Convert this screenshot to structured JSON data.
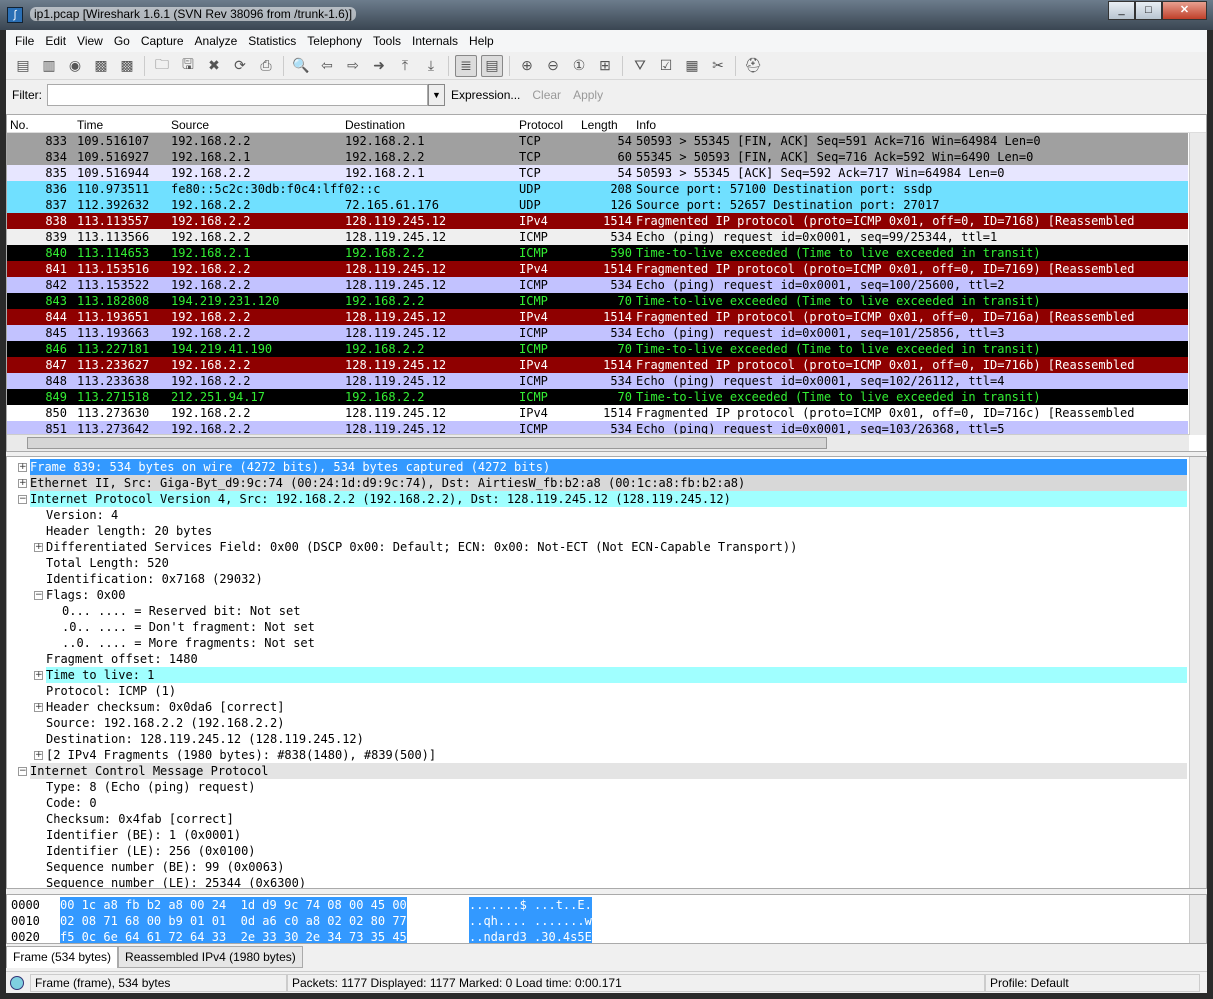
{
  "window": {
    "title": "ip1.pcap  [Wireshark 1.6.1  (SVN Rev 38096 from /trunk-1.6)]",
    "controls": [
      "_",
      "□",
      "✕"
    ]
  },
  "menu": [
    "File",
    "Edit",
    "View",
    "Go",
    "Capture",
    "Analyze",
    "Statistics",
    "Telephony",
    "Tools",
    "Internals",
    "Help"
  ],
  "toolbar": [
    {
      "icon": "interface-list-icon",
      "g": "▤"
    },
    {
      "icon": "capture-options-icon",
      "g": "▥"
    },
    {
      "icon": "capture-start-icon",
      "g": "◉"
    },
    {
      "icon": "capture-stop-icon",
      "g": "▩"
    },
    {
      "icon": "capture-restart-icon",
      "g": "▩"
    },
    {
      "sep": true
    },
    {
      "icon": "open-file-icon",
      "g": "🗀"
    },
    {
      "icon": "save-icon",
      "g": "🖫"
    },
    {
      "icon": "close-file-icon",
      "g": "✖"
    },
    {
      "icon": "reload-icon",
      "g": "⟳"
    },
    {
      "icon": "print-icon",
      "g": "⎙"
    },
    {
      "sep": true
    },
    {
      "icon": "find-icon",
      "g": "🔍"
    },
    {
      "icon": "go-back-icon",
      "g": "⇦"
    },
    {
      "icon": "go-forward-icon",
      "g": "⇨"
    },
    {
      "icon": "go-to-packet-icon",
      "g": "➜"
    },
    {
      "icon": "go-first-icon",
      "g": "⤒"
    },
    {
      "icon": "go-last-icon",
      "g": "⤓"
    },
    {
      "sep": true
    },
    {
      "icon": "colorize-icon",
      "g": "≣",
      "on": true
    },
    {
      "icon": "autoscroll-icon",
      "g": "▤",
      "on": true
    },
    {
      "sep": true
    },
    {
      "icon": "zoom-in-icon",
      "g": "⊕"
    },
    {
      "icon": "zoom-out-icon",
      "g": "⊖"
    },
    {
      "icon": "zoom-normal-icon",
      "g": "①"
    },
    {
      "icon": "resize-columns-icon",
      "g": "⊞"
    },
    {
      "sep": true
    },
    {
      "icon": "capture-filters-icon",
      "g": "⛛"
    },
    {
      "icon": "display-filters-icon",
      "g": "☑"
    },
    {
      "icon": "coloring-rules-icon",
      "g": "▦"
    },
    {
      "icon": "preferences-icon",
      "g": "✂"
    },
    {
      "sep": true
    },
    {
      "icon": "help-icon",
      "g": "⛑"
    }
  ],
  "filter": {
    "label": "Filter:",
    "value": "",
    "expression": "Expression...",
    "clear": "Clear",
    "apply": "Apply"
  },
  "packet_list": {
    "columns": [
      "No.",
      "Time",
      "Source",
      "Destination",
      "Protocol",
      "Length",
      "Info"
    ],
    "rows": [
      {
        "no": "833",
        "time": "109.516107",
        "src": "192.168.2.2",
        "dst": "192.168.2.1",
        "proto": "TCP",
        "len": "54",
        "info": "50593 > 55345 [FIN, ACK] Seq=591 Ack=716 Win=64984 Len=0",
        "bg": "#a0a0a0",
        "fg": "#000000"
      },
      {
        "no": "834",
        "time": "109.516927",
        "src": "192.168.2.1",
        "dst": "192.168.2.2",
        "proto": "TCP",
        "len": "60",
        "info": "55345 > 50593 [FIN, ACK] Seq=716 Ack=592 Win=6490 Len=0",
        "bg": "#a0a0a0",
        "fg": "#000000"
      },
      {
        "no": "835",
        "time": "109.516944",
        "src": "192.168.2.2",
        "dst": "192.168.2.1",
        "proto": "TCP",
        "len": "54",
        "info": "50593 > 55345 [ACK] Seq=592 Ack=717 Win=64984 Len=0",
        "bg": "#e7e6ff",
        "fg": "#000000"
      },
      {
        "no": "836",
        "time": "110.973511",
        "src": "fe80::5c2c:30db:f0c4:lff02::c",
        "dst": "",
        "proto": "UDP",
        "len": "208",
        "info": "Source port: 57100  Destination port: ssdp",
        "bg": "#70e0ff",
        "fg": "#000000"
      },
      {
        "no": "837",
        "time": "112.392632",
        "src": "192.168.2.2",
        "dst": "72.165.61.176",
        "proto": "UDP",
        "len": "126",
        "info": "Source port: 52657  Destination port: 27017",
        "bg": "#70e0ff",
        "fg": "#000000"
      },
      {
        "no": "838",
        "time": "113.113557",
        "src": "192.168.2.2",
        "dst": "128.119.245.12",
        "proto": "IPv4",
        "len": "1514",
        "info": "Fragmented IP protocol (proto=ICMP 0x01, off=0, ID=7168) [Reassembled",
        "bg": "#8f0000",
        "fg": "#ffffff"
      },
      {
        "no": "839",
        "time": "113.113566",
        "src": "192.168.2.2",
        "dst": "128.119.245.12",
        "proto": "ICMP",
        "len": "534",
        "info": "Echo (ping) request  id=0x0001, seq=99/25344, ttl=1",
        "bg": "#efefef",
        "fg": "#000000"
      },
      {
        "no": "840",
        "time": "113.114653",
        "src": "192.168.2.1",
        "dst": "192.168.2.2",
        "proto": "ICMP",
        "len": "590",
        "info": "Time-to-live exceeded (Time to live exceeded in transit)",
        "bg": "#000000",
        "fg": "#33ee33"
      },
      {
        "no": "841",
        "time": "113.153516",
        "src": "192.168.2.2",
        "dst": "128.119.245.12",
        "proto": "IPv4",
        "len": "1514",
        "info": "Fragmented IP protocol (proto=ICMP 0x01, off=0, ID=7169) [Reassembled",
        "bg": "#8f0000",
        "fg": "#ffffff"
      },
      {
        "no": "842",
        "time": "113.153522",
        "src": "192.168.2.2",
        "dst": "128.119.245.12",
        "proto": "ICMP",
        "len": "534",
        "info": "Echo (ping) request  id=0x0001, seq=100/25600, ttl=2",
        "bg": "#c2c2ff",
        "fg": "#000000"
      },
      {
        "no": "843",
        "time": "113.182808",
        "src": "194.219.231.120",
        "dst": "192.168.2.2",
        "proto": "ICMP",
        "len": "70",
        "info": "Time-to-live exceeded (Time to live exceeded in transit)",
        "bg": "#000000",
        "fg": "#33ee33"
      },
      {
        "no": "844",
        "time": "113.193651",
        "src": "192.168.2.2",
        "dst": "128.119.245.12",
        "proto": "IPv4",
        "len": "1514",
        "info": "Fragmented IP protocol (proto=ICMP 0x01, off=0, ID=716a) [Reassembled",
        "bg": "#8f0000",
        "fg": "#ffffff"
      },
      {
        "no": "845",
        "time": "113.193663",
        "src": "192.168.2.2",
        "dst": "128.119.245.12",
        "proto": "ICMP",
        "len": "534",
        "info": "Echo (ping) request  id=0x0001, seq=101/25856, ttl=3",
        "bg": "#c2c2ff",
        "fg": "#000000"
      },
      {
        "no": "846",
        "time": "113.227181",
        "src": "194.219.41.190",
        "dst": "192.168.2.2",
        "proto": "ICMP",
        "len": "70",
        "info": "Time-to-live exceeded (Time to live exceeded in transit)",
        "bg": "#000000",
        "fg": "#33ee33"
      },
      {
        "no": "847",
        "time": "113.233627",
        "src": "192.168.2.2",
        "dst": "128.119.245.12",
        "proto": "IPv4",
        "len": "1514",
        "info": "Fragmented IP protocol (proto=ICMP 0x01, off=0, ID=716b) [Reassembled",
        "bg": "#8f0000",
        "fg": "#ffffff"
      },
      {
        "no": "848",
        "time": "113.233638",
        "src": "192.168.2.2",
        "dst": "128.119.245.12",
        "proto": "ICMP",
        "len": "534",
        "info": "Echo (ping) request  id=0x0001, seq=102/26112, ttl=4",
        "bg": "#c2c2ff",
        "fg": "#000000"
      },
      {
        "no": "849",
        "time": "113.271518",
        "src": "212.251.94.17",
        "dst": "192.168.2.2",
        "proto": "ICMP",
        "len": "70",
        "info": "Time-to-live exceeded (Time to live exceeded in transit)",
        "bg": "#000000",
        "fg": "#33ee33"
      },
      {
        "no": "850",
        "time": "113.273630",
        "src": "192.168.2.2",
        "dst": "128.119.245.12",
        "proto": "IPv4",
        "len": "1514",
        "info": "Fragmented IP protocol (proto=ICMP 0x01, off=0, ID=716c) [Reassembled",
        "bg": "#ffffff",
        "fg": "#000000"
      },
      {
        "no": "851",
        "time": "113.273642",
        "src": "192.168.2.2",
        "dst": "128.119.245.12",
        "proto": "ICMP",
        "len": "534",
        "info": "Echo (ping) request  id=0x0001, seq=103/26368, ttl=5",
        "bg": "#c2c2ff",
        "fg": "#000000"
      }
    ]
  },
  "details": [
    {
      "lvl": 0,
      "exp": "+",
      "text": "Frame 839: 534 bytes on wire (4272 bits), 534 bytes captured (4272 bits)",
      "bg": "#3399ff",
      "fg": "#ffffff"
    },
    {
      "lvl": 0,
      "exp": "+",
      "text": "Ethernet II, Src: Giga-Byt_d9:9c:74 (00:24:1d:d9:9c:74), Dst: AirtiesW_fb:b2:a8 (00:1c:a8:fb:b2:a8)",
      "bg": "#d8d8d8"
    },
    {
      "lvl": 0,
      "exp": "−",
      "text": "Internet Protocol Version 4, Src: 192.168.2.2 (192.168.2.2), Dst: 128.119.245.12 (128.119.245.12)",
      "bg": "#a0ffff"
    },
    {
      "lvl": 1,
      "text": "Version: 4"
    },
    {
      "lvl": 1,
      "text": "Header length: 20 bytes"
    },
    {
      "lvl": 1,
      "exp": "+",
      "text": "Differentiated Services Field: 0x00 (DSCP 0x00: Default; ECN: 0x00: Not-ECT (Not ECN-Capable Transport))"
    },
    {
      "lvl": 1,
      "text": "Total Length: 520"
    },
    {
      "lvl": 1,
      "text": "Identification: 0x7168 (29032)"
    },
    {
      "lvl": 1,
      "exp": "−",
      "text": "Flags: 0x00"
    },
    {
      "lvl": 2,
      "text": "0... .... = Reserved bit: Not set"
    },
    {
      "lvl": 2,
      "text": ".0.. .... = Don't fragment: Not set"
    },
    {
      "lvl": 2,
      "text": "..0. .... = More fragments: Not set"
    },
    {
      "lvl": 1,
      "text": "Fragment offset: 1480"
    },
    {
      "lvl": 1,
      "exp": "+",
      "text": "Time to live: 1",
      "bg": "#a0ffff"
    },
    {
      "lvl": 1,
      "text": "Protocol: ICMP (1)"
    },
    {
      "lvl": 1,
      "exp": "+",
      "text": "Header checksum: 0x0da6 [correct]"
    },
    {
      "lvl": 1,
      "text": "Source: 192.168.2.2 (192.168.2.2)"
    },
    {
      "lvl": 1,
      "text": "Destination: 128.119.245.12 (128.119.245.12)"
    },
    {
      "lvl": 1,
      "exp": "+",
      "text": "[2 IPv4 Fragments (1980 bytes): #838(1480), #839(500)]"
    },
    {
      "lvl": 0,
      "exp": "−",
      "text": "Internet Control Message Protocol",
      "bg": "#e4e4e4"
    },
    {
      "lvl": 1,
      "text": "Type: 8 (Echo (ping) request)"
    },
    {
      "lvl": 1,
      "text": "Code: 0"
    },
    {
      "lvl": 1,
      "text": "Checksum: 0x4fab [correct]"
    },
    {
      "lvl": 1,
      "text": "Identifier (BE): 1 (0x0001)"
    },
    {
      "lvl": 1,
      "text": "Identifier (LE): 256 (0x0100)"
    },
    {
      "lvl": 1,
      "text": "Sequence number (BE): 99 (0x0063)"
    },
    {
      "lvl": 1,
      "text": "Sequence number (LE): 25344 (0x6300)"
    }
  ],
  "bytes": [
    {
      "off": "0000",
      "hex": "00 1c a8 fb b2 a8 00 24  1d d9 9c 74 08 00 45 00",
      "ascii": ".......$ ...t..E."
    },
    {
      "off": "0010",
      "hex": "02 08 71 68 00 b9 01 01  0d a6 c0 a8 02 02 80 77",
      "ascii": "..qh.... .......w"
    },
    {
      "off": "0020",
      "hex": "f5 0c 6e 64 61 72 64 33  2e 33 30 2e 34 73 35 45",
      "ascii": "..ndard3 .30.4s5E"
    }
  ],
  "byte_tabs": [
    "Frame (534 bytes)",
    "Reassembled IPv4 (1980 bytes)"
  ],
  "status": {
    "field": "Frame (frame), 534 bytes",
    "packets": "Packets: 1177 Displayed: 1177 Marked: 0 Load time: 0:00.171",
    "profile": "Profile: Default"
  }
}
